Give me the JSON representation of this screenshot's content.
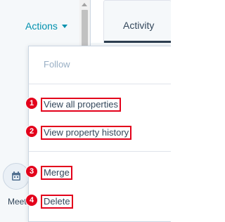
{
  "actions_button": {
    "label": "Actions",
    "color": "#0091ae"
  },
  "tabs": {
    "activity": "Activity"
  },
  "quick_actions": {
    "meetings_label": "Meet",
    "meetings_icon": "calendar-icon"
  },
  "menu": {
    "items": [
      {
        "label": "Follow",
        "enabled": false
      },
      {
        "label": "View all properties",
        "badge": "1"
      },
      {
        "label": "View property history",
        "badge": "2"
      },
      {
        "label": "Merge",
        "badge": "3"
      },
      {
        "label": "Delete",
        "badge": "4"
      }
    ]
  },
  "colors": {
    "annotation_red": "#e3001b",
    "text": "#33475b",
    "disabled_text": "#99afc4",
    "border": "#cbd6e2"
  }
}
